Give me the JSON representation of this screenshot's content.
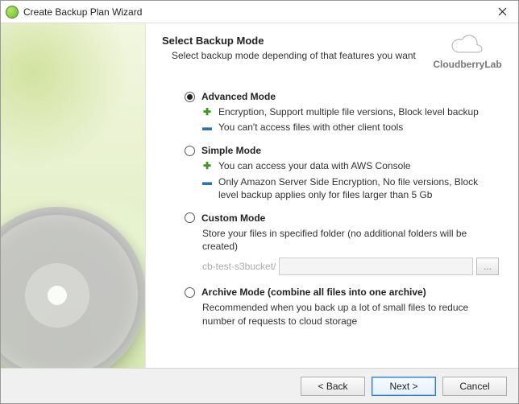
{
  "window": {
    "title": "Create Backup Plan Wizard"
  },
  "header": {
    "heading": "Select Backup Mode",
    "subheading": "Select backup mode depending of that features you want"
  },
  "brand": {
    "name": "CloudberryLab"
  },
  "modes": {
    "advanced": {
      "title": "Advanced Mode",
      "plus": "Encryption, Support multiple file versions, Block level backup",
      "minus": "You can't access files with other client tools",
      "selected": true
    },
    "simple": {
      "title": "Simple Mode",
      "plus": "You can access your data with AWS Console",
      "minus": "Only Amazon Server Side Encryption, No file versions, Block level backup applies only for files larger than 5 Gb",
      "selected": false
    },
    "custom": {
      "title": "Custom Mode",
      "desc": "Store your files in specified folder (no additional folders will be created)",
      "path_prefix": "cb-test-s3bucket/",
      "path_value": "",
      "browse_label": "...",
      "selected": false
    },
    "archive": {
      "title": "Archive Mode (combine all files into one archive)",
      "desc": "Recommended when you back up a lot of small files to reduce number of requests to cloud storage",
      "selected": false
    }
  },
  "footer": {
    "back": "< Back",
    "next": "Next >",
    "cancel": "Cancel"
  }
}
